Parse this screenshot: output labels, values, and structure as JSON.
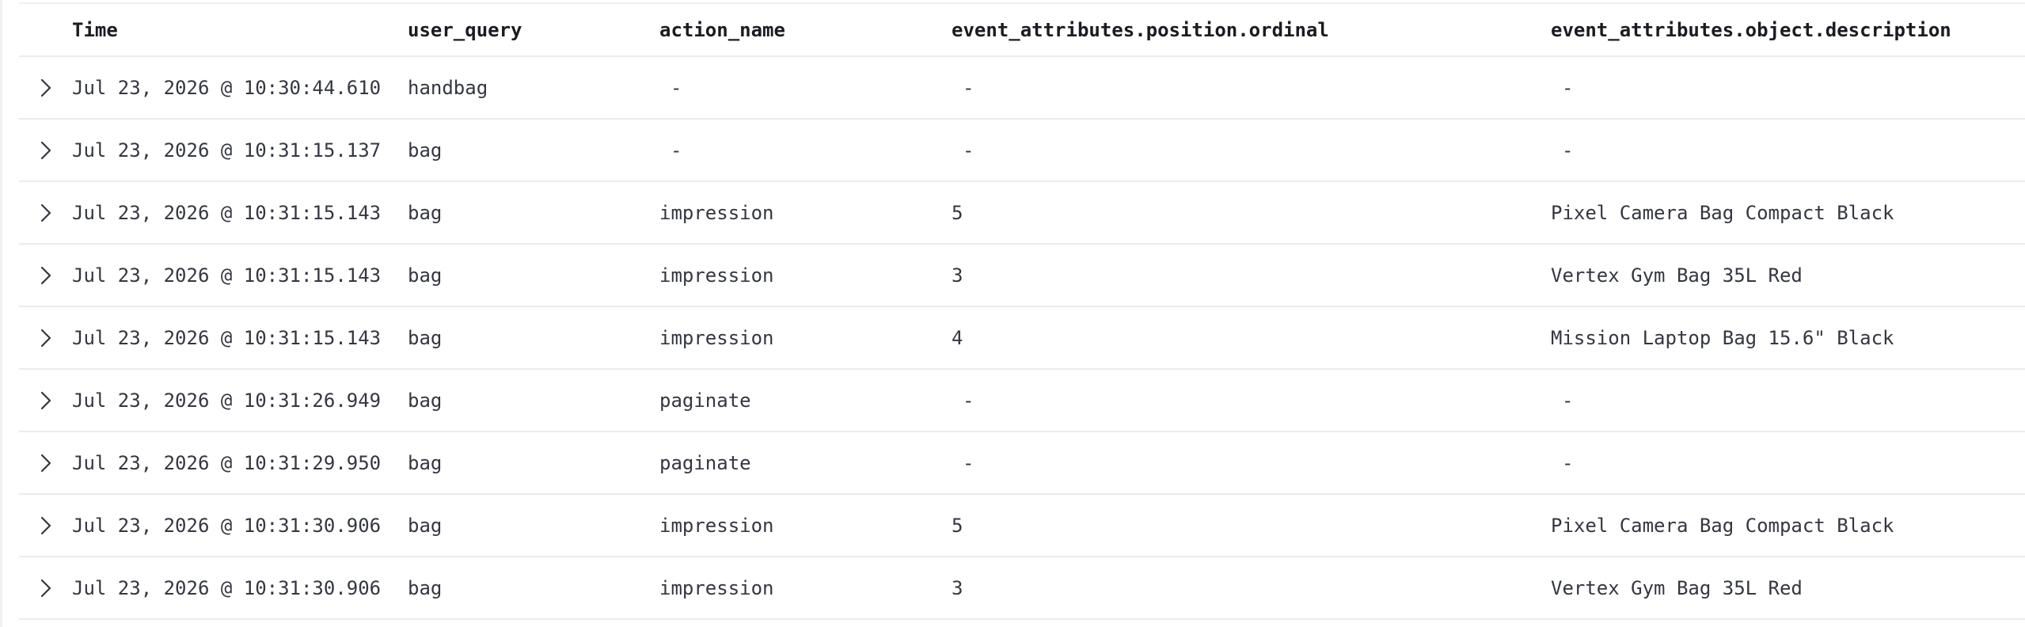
{
  "columns": {
    "time": "Time",
    "user_query": "user_query",
    "action_name": "action_name",
    "ordinal": "event_attributes.position.ordinal",
    "description": "event_attributes.object.description"
  },
  "rows": [
    {
      "time": "Jul 23, 2026 @ 10:30:44.610",
      "user_query": "handbag",
      "action_name": "-",
      "ordinal": "-",
      "description": "-"
    },
    {
      "time": "Jul 23, 2026 @ 10:31:15.137",
      "user_query": "bag",
      "action_name": "-",
      "ordinal": "-",
      "description": "-"
    },
    {
      "time": "Jul 23, 2026 @ 10:31:15.143",
      "user_query": "bag",
      "action_name": "impression",
      "ordinal": "5",
      "description": "Pixel Camera Bag Compact Black"
    },
    {
      "time": "Jul 23, 2026 @ 10:31:15.143",
      "user_query": "bag",
      "action_name": "impression",
      "ordinal": "3",
      "description": "Vertex Gym Bag 35L Red"
    },
    {
      "time": "Jul 23, 2026 @ 10:31:15.143",
      "user_query": "bag",
      "action_name": "impression",
      "ordinal": "4",
      "description": "Mission Laptop Bag 15.6\" Black"
    },
    {
      "time": "Jul 23, 2026 @ 10:31:26.949",
      "user_query": "bag",
      "action_name": "paginate",
      "ordinal": "-",
      "description": "-"
    },
    {
      "time": "Jul 23, 2026 @ 10:31:29.950",
      "user_query": "bag",
      "action_name": "paginate",
      "ordinal": "-",
      "description": "-"
    },
    {
      "time": "Jul 23, 2026 @ 10:31:30.906",
      "user_query": "bag",
      "action_name": "impression",
      "ordinal": "5",
      "description": "Pixel Camera Bag Compact Black"
    },
    {
      "time": "Jul 23, 2026 @ 10:31:30.906",
      "user_query": "bag",
      "action_name": "impression",
      "ordinal": "3",
      "description": "Vertex Gym Bag 35L Red"
    }
  ],
  "icons": {
    "expand": "chevron-right-icon"
  },
  "colors": {
    "text": "#343741",
    "header_text": "#1a1c21",
    "row_border": "#e9ebef"
  }
}
